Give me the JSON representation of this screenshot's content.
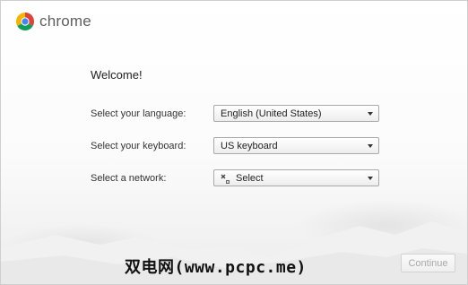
{
  "brand": {
    "name": "chrome",
    "logo_icon": "chrome-logo-icon"
  },
  "welcome": {
    "heading": "Welcome!"
  },
  "settings": {
    "language": {
      "label": "Select your language:",
      "value": "English (United States)"
    },
    "keyboard": {
      "label": "Select your keyboard:",
      "value": "US keyboard"
    },
    "network": {
      "label": "Select a network:",
      "value": "Select",
      "icon": "network-disconnected-icon"
    }
  },
  "footer": {
    "continue_label": "Continue",
    "continue_enabled": false,
    "watermark_text": "双电网(www.pcpc.me)"
  },
  "colors": {
    "chrome_red": "#db4437",
    "chrome_green": "#0f9d58",
    "chrome_yellow": "#f4b400",
    "chrome_blue": "#4285f4"
  }
}
